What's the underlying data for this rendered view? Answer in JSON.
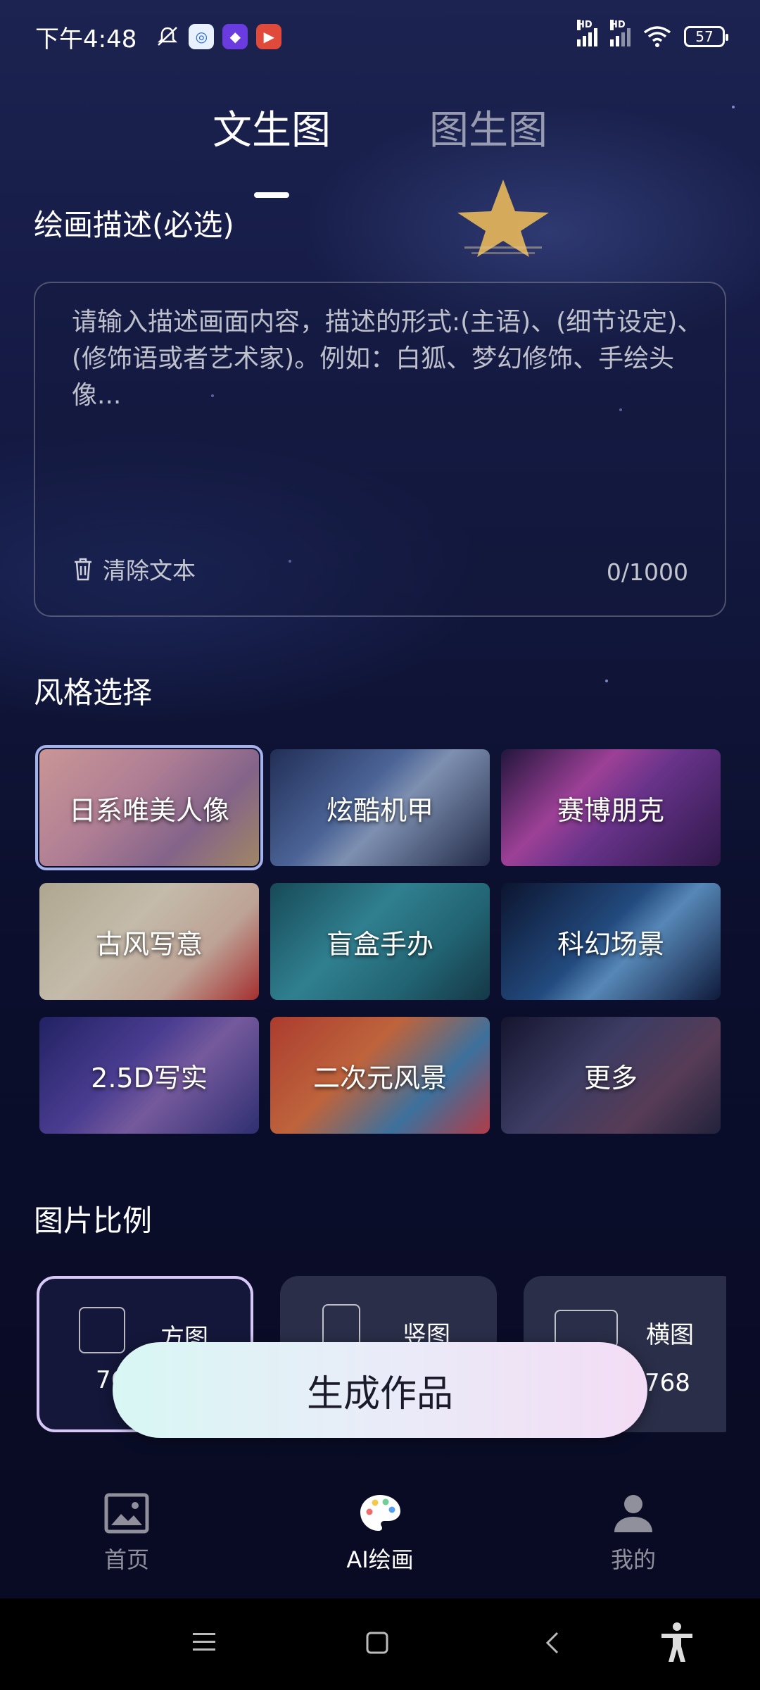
{
  "status_bar": {
    "time": "下午4:48",
    "battery": "57",
    "hd1": "HD",
    "hd2": "HD"
  },
  "tabs": [
    {
      "label": "文生图",
      "active": true
    },
    {
      "label": "图生图",
      "active": false
    }
  ],
  "description": {
    "title": "绘画描述(必选)",
    "placeholder": "请输入描述画面内容，描述的形式:(主语)、(细节设定)、(修饰语或者艺术家)。例如：白狐、梦幻修饰、手绘头像...",
    "clear_label": "清除文本",
    "counter": "0/1000"
  },
  "style": {
    "title": "风格选择",
    "items": [
      {
        "label": "日系唯美人像",
        "selected": true
      },
      {
        "label": "炫酷机甲"
      },
      {
        "label": "赛博朋克"
      },
      {
        "label": "古风写意"
      },
      {
        "label": "盲盒手办"
      },
      {
        "label": "科幻场景"
      },
      {
        "label": "2.5D写实"
      },
      {
        "label": "二次元风景"
      },
      {
        "label": "更多"
      }
    ]
  },
  "ratio": {
    "title": "图片比例",
    "items": [
      {
        "name": "方图",
        "dims": "76",
        "selected": true
      },
      {
        "name": "竖图",
        "dims": ""
      },
      {
        "name": "横图",
        "dims": "768"
      }
    ]
  },
  "generate_label": "生成作品",
  "bottom_nav": [
    {
      "label": "首页",
      "icon": "image-icon"
    },
    {
      "label": "AI绘画",
      "icon": "palette-icon",
      "active": true
    },
    {
      "label": "我的",
      "icon": "user-icon"
    }
  ],
  "colors": {
    "accent_gradient_start": "#d8f7f4",
    "accent_gradient_end": "#f3dcf5",
    "selected_border": "#d7c8f7"
  }
}
